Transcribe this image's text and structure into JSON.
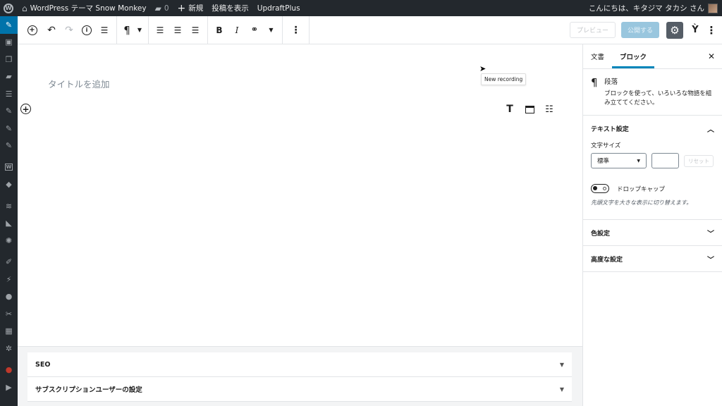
{
  "admin_bar": {
    "site_name": "WordPress テーマ Snow Monkey",
    "comments_count": "0",
    "new_label": "新規",
    "view_post": "投稿を表示",
    "updraft": "UpdraftPlus",
    "greeting": "こんにちは、キタジマ タカシ さん"
  },
  "admin_menu": {
    "items": [
      "dashboard-icon",
      "pin-icon",
      "media-icon",
      "pages-icon",
      "comments-icon",
      "list-icon",
      "pin-icon",
      "pin-icon",
      "pin-icon",
      "woocommerce-icon",
      "products-icon",
      "layers-icon",
      "megaphone-icon",
      "tools-icon",
      "appearance-icon",
      "plugins-icon",
      "users-icon",
      "wrench-icon",
      "settings-grid-icon",
      "gear-icon",
      "plugin-icon",
      "play-icon"
    ],
    "active_index": 1
  },
  "header": {
    "preview_label": "プレビュー",
    "publish_label": "公開する"
  },
  "editor": {
    "title_placeholder": "タイトルを追加",
    "tooltip": "New recording"
  },
  "metaboxes": [
    {
      "label": "SEO"
    },
    {
      "label": "サブスクリプションユーザーの設定"
    }
  ],
  "sidebar": {
    "tab_document": "文書",
    "tab_block": "ブロック",
    "block_title": "段落",
    "block_description": "ブロックを使って、いろいろな物語を組み立ててください。",
    "text_settings": "テキスト設定",
    "font_size_label": "文字サイズ",
    "font_size_value": "標準",
    "reset_label": "リセット",
    "drop_cap_label": "ドロップキャップ",
    "drop_cap_help": "先頭文字を大きな表示に切り替えます。",
    "color_settings": "色設定",
    "advanced_settings": "高度な設定"
  },
  "colors": {
    "admin_bar": "#23282d",
    "accent": "#0073aa",
    "publish_disabled": "#99c6de"
  }
}
